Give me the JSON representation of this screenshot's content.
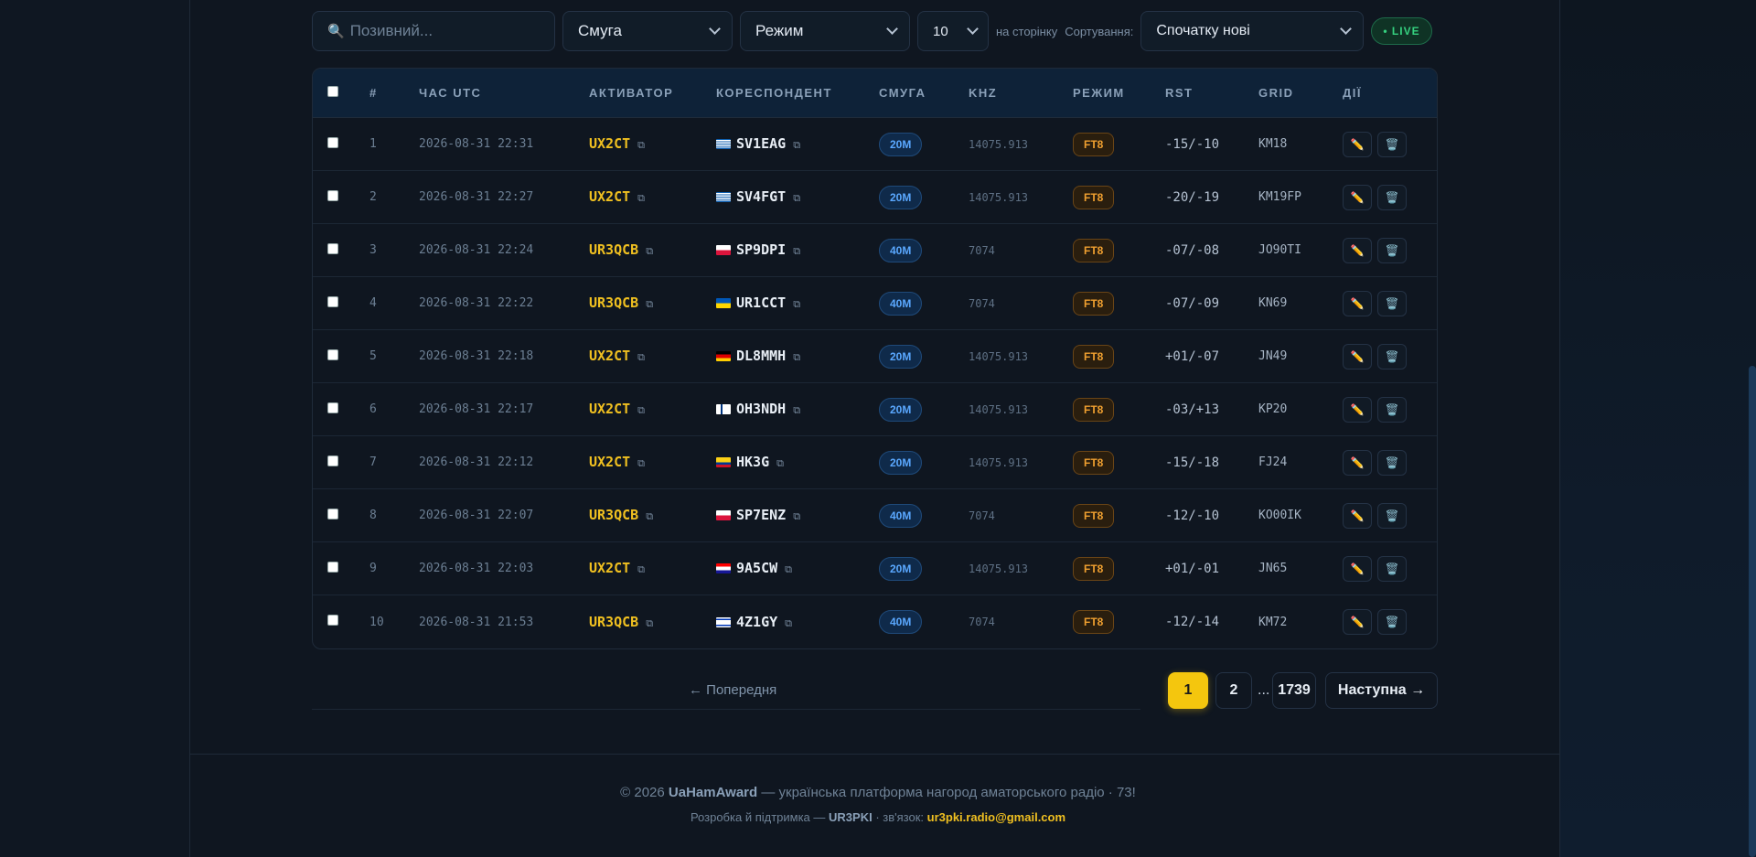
{
  "toolbar": {
    "search_placeholder": "Позивний...",
    "band_select": "Смуга",
    "mode_select": "Режим",
    "per_page": "10",
    "per_page_label": "на сторінку",
    "sort_label": "Сортування:",
    "sort_value": "Спочатку нові",
    "live_label": "• LIVE"
  },
  "table": {
    "headers": [
      "#",
      "Час UTC",
      "Активатор",
      "Кореспондент",
      "Смуга",
      "kHz",
      "Режим",
      "RST",
      "Grid",
      "Дії"
    ],
    "rows": [
      {
        "n": "1",
        "time": "2026-08-31 22:31",
        "activator": "UX2CT",
        "flag": "gr",
        "corr": "SV1EAG",
        "band": "20M",
        "khz": "14075.913",
        "mode": "FT8",
        "rst": "-15/-10",
        "grid": "KM18"
      },
      {
        "n": "2",
        "time": "2026-08-31 22:27",
        "activator": "UX2CT",
        "flag": "gr",
        "corr": "SV4FGT",
        "band": "20M",
        "khz": "14075.913",
        "mode": "FT8",
        "rst": "-20/-19",
        "grid": "KM19FP"
      },
      {
        "n": "3",
        "time": "2026-08-31 22:24",
        "activator": "UR3QCB",
        "flag": "pl",
        "corr": "SP9DPI",
        "band": "40M",
        "khz": "7074",
        "mode": "FT8",
        "rst": "-07/-08",
        "grid": "JO90TI"
      },
      {
        "n": "4",
        "time": "2026-08-31 22:22",
        "activator": "UR3QCB",
        "flag": "ua",
        "corr": "UR1CCT",
        "band": "40M",
        "khz": "7074",
        "mode": "FT8",
        "rst": "-07/-09",
        "grid": "KN69"
      },
      {
        "n": "5",
        "time": "2026-08-31 22:18",
        "activator": "UX2CT",
        "flag": "de",
        "corr": "DL8MMH",
        "band": "20M",
        "khz": "14075.913",
        "mode": "FT8",
        "rst": "+01/-07",
        "grid": "JN49"
      },
      {
        "n": "6",
        "time": "2026-08-31 22:17",
        "activator": "UX2CT",
        "flag": "fi",
        "corr": "OH3NDH",
        "band": "20M",
        "khz": "14075.913",
        "mode": "FT8",
        "rst": "-03/+13",
        "grid": "KP20"
      },
      {
        "n": "7",
        "time": "2026-08-31 22:12",
        "activator": "UX2CT",
        "flag": "co",
        "corr": "HK3G",
        "band": "20M",
        "khz": "14075.913",
        "mode": "FT8",
        "rst": "-15/-18",
        "grid": "FJ24"
      },
      {
        "n": "8",
        "time": "2026-08-31 22:07",
        "activator": "UR3QCB",
        "flag": "pl",
        "corr": "SP7ENZ",
        "band": "40M",
        "khz": "7074",
        "mode": "FT8",
        "rst": "-12/-10",
        "grid": "KO00IK"
      },
      {
        "n": "9",
        "time": "2026-08-31 22:03",
        "activator": "UX2CT",
        "flag": "hr",
        "corr": "9A5CW",
        "band": "20M",
        "khz": "14075.913",
        "mode": "FT8",
        "rst": "+01/-01",
        "grid": "JN65"
      },
      {
        "n": "10",
        "time": "2026-08-31 21:53",
        "activator": "UR3QCB",
        "flag": "il",
        "corr": "4Z1GY",
        "band": "40M",
        "khz": "7074",
        "mode": "FT8",
        "rst": "-12/-14",
        "grid": "KM72"
      }
    ],
    "icons": {
      "external": "external-link-icon",
      "edit": "pencil-icon",
      "delete": "trash-icon"
    }
  },
  "pagination": {
    "prev": "← Попередня",
    "pages": [
      "1",
      "2"
    ],
    "dots": "...",
    "last": "1739",
    "next": "Наступна →",
    "active_color": "#f4c60e"
  },
  "footer": {
    "copyright": "© 2026",
    "brand": "UaHamAward",
    "tagline": "— українська платформа нагород аматорського радіо · 73!",
    "dev_prefix": "Розробка й підтримка —",
    "dev_call": "UR3PKI",
    "contact_prefix": "· зв'язок:",
    "email": "ur3pki.radio@gmail.com"
  },
  "colors": {
    "accent": "#f0c020",
    "band_badge": "#5aa8ff",
    "mode_badge": "#f0a030",
    "live": "#35d07f"
  }
}
